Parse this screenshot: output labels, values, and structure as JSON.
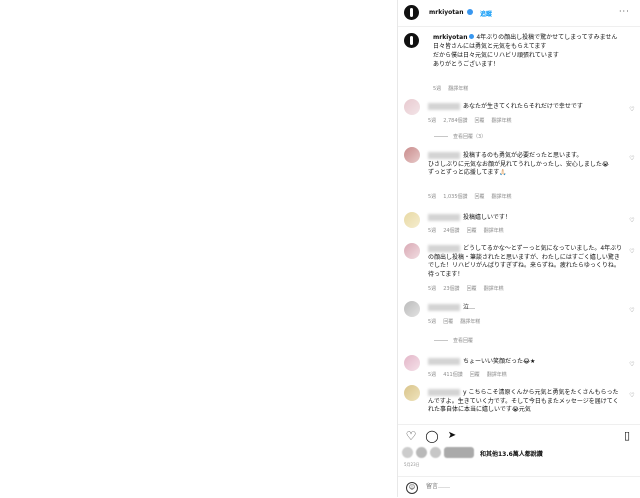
{
  "post": {
    "username": "mrkiyotan",
    "follow_label": "追蹤",
    "more": "···",
    "caption": "4年ぶりの顔出し投稿で驚かせてしまってすみません\n日々皆さんには勇気と元気をもらえてます\nだから僕は日々元気にリハビリ頑張れています\nありがとうございます！",
    "caption_time": "5週",
    "caption_translate": "翻譯年糕"
  },
  "comments": [
    {
      "text": "あなたが生きてくれたらそれだけで幸せです",
      "time": "5週",
      "likes": "2,784個讚",
      "reply": "回覆",
      "translate": "翻譯年糕",
      "view_replies": "查看回覆（3）"
    },
    {
      "text": "投稿するのも勇気が必要だったと思います。\nひさしぶりに元気なお顔が見れてうれしかったし、安心しました😭\nずっとずっと応援してます🙏🏻",
      "time": "5週",
      "likes": "1,035個讚",
      "reply": "回覆",
      "translate": "翻譯年糕"
    },
    {
      "text": "投稿嬉しいです！",
      "time": "5週",
      "likes": "24個讚",
      "reply": "回覆",
      "translate": "翻譯年糕"
    },
    {
      "text": "どうしてるかな〜とずーっと気になっていました。4年ぶりの顔出し投稿・筆談されたと思いますが、わたしにはすごく嬉しい驚きでした！リハビリがんばりすぎずね。来らずね。疲れたらゆっくりね。待ってます！",
      "time": "5週",
      "likes": "23個讚",
      "reply": "回覆",
      "translate": "翻譯年糕"
    },
    {
      "text": "泣…",
      "time": "5週",
      "likes": "",
      "reply": "回覆",
      "translate": "翻譯年糕",
      "view_replies": "查看回覆"
    },
    {
      "text": "ちょーいい笑顔だった😂★",
      "time": "5週",
      "likes": "411個讚",
      "reply": "回覆",
      "translate": "翻譯年糕"
    },
    {
      "text": "y こちらこそ清原くんから元気と勇気をたくさんもらったんですよ。生きていく力です。そして今日もまたメッセージを届けてくれた事自体に本当に嬉しいです😭元気",
      "time": "",
      "likes": "",
      "reply": "",
      "translate": ""
    }
  ],
  "actions": {
    "likes_text": "和其他13.6萬人都說讚",
    "date": "5月23日",
    "comment_placeholder": "留言……"
  }
}
